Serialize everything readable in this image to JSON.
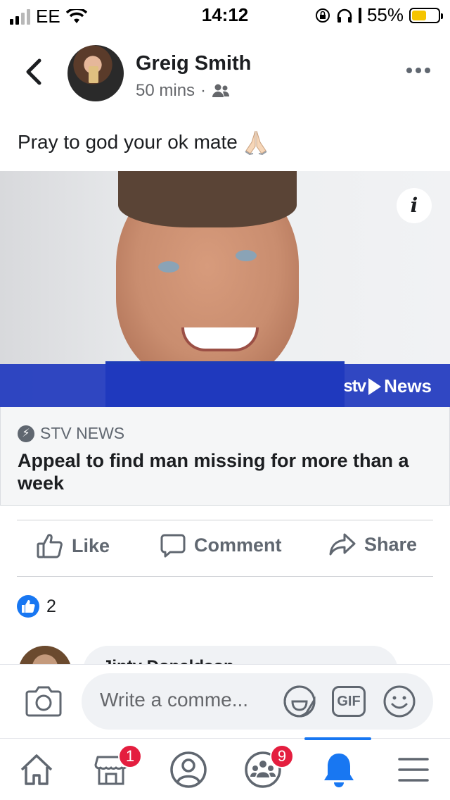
{
  "status_bar": {
    "carrier": "EE",
    "time": "14:12",
    "battery_percent": "55%",
    "battery_level": 0.55,
    "icons": [
      "signal-icon",
      "wifi-icon",
      "orientation-lock-icon",
      "headphones-icon",
      "battery-icon"
    ]
  },
  "post": {
    "author": "Greig Smith",
    "time_ago": "50 mins",
    "separator": "·",
    "audience_icon": "friends-icon",
    "text": "Pray to god your ok mate",
    "emoji": "folded-hands-emoji"
  },
  "link_preview": {
    "source": "STV NEWS",
    "headline": "Appeal to find man missing for more than a week",
    "logo_mark": "stv",
    "logo_text": "News",
    "info_label": "i"
  },
  "actions": {
    "like": "Like",
    "comment": "Comment",
    "share": "Share"
  },
  "reactions": {
    "count": "2"
  },
  "comment_peek": {
    "name": "Jinty Donaldson"
  },
  "composer": {
    "placeholder": "Write a comme...",
    "gif_label": "GIF"
  },
  "tabbar": {
    "tabs": [
      {
        "name": "home",
        "badge": ""
      },
      {
        "name": "marketplace",
        "badge": "1"
      },
      {
        "name": "profile",
        "badge": ""
      },
      {
        "name": "groups",
        "badge": "9"
      },
      {
        "name": "notifications",
        "badge": "",
        "active": true
      },
      {
        "name": "menu",
        "badge": ""
      }
    ]
  },
  "colors": {
    "accent": "#1877f2",
    "badge": "#e41e3f",
    "stv_blue": "#2038be",
    "text_secondary": "#65676b"
  }
}
